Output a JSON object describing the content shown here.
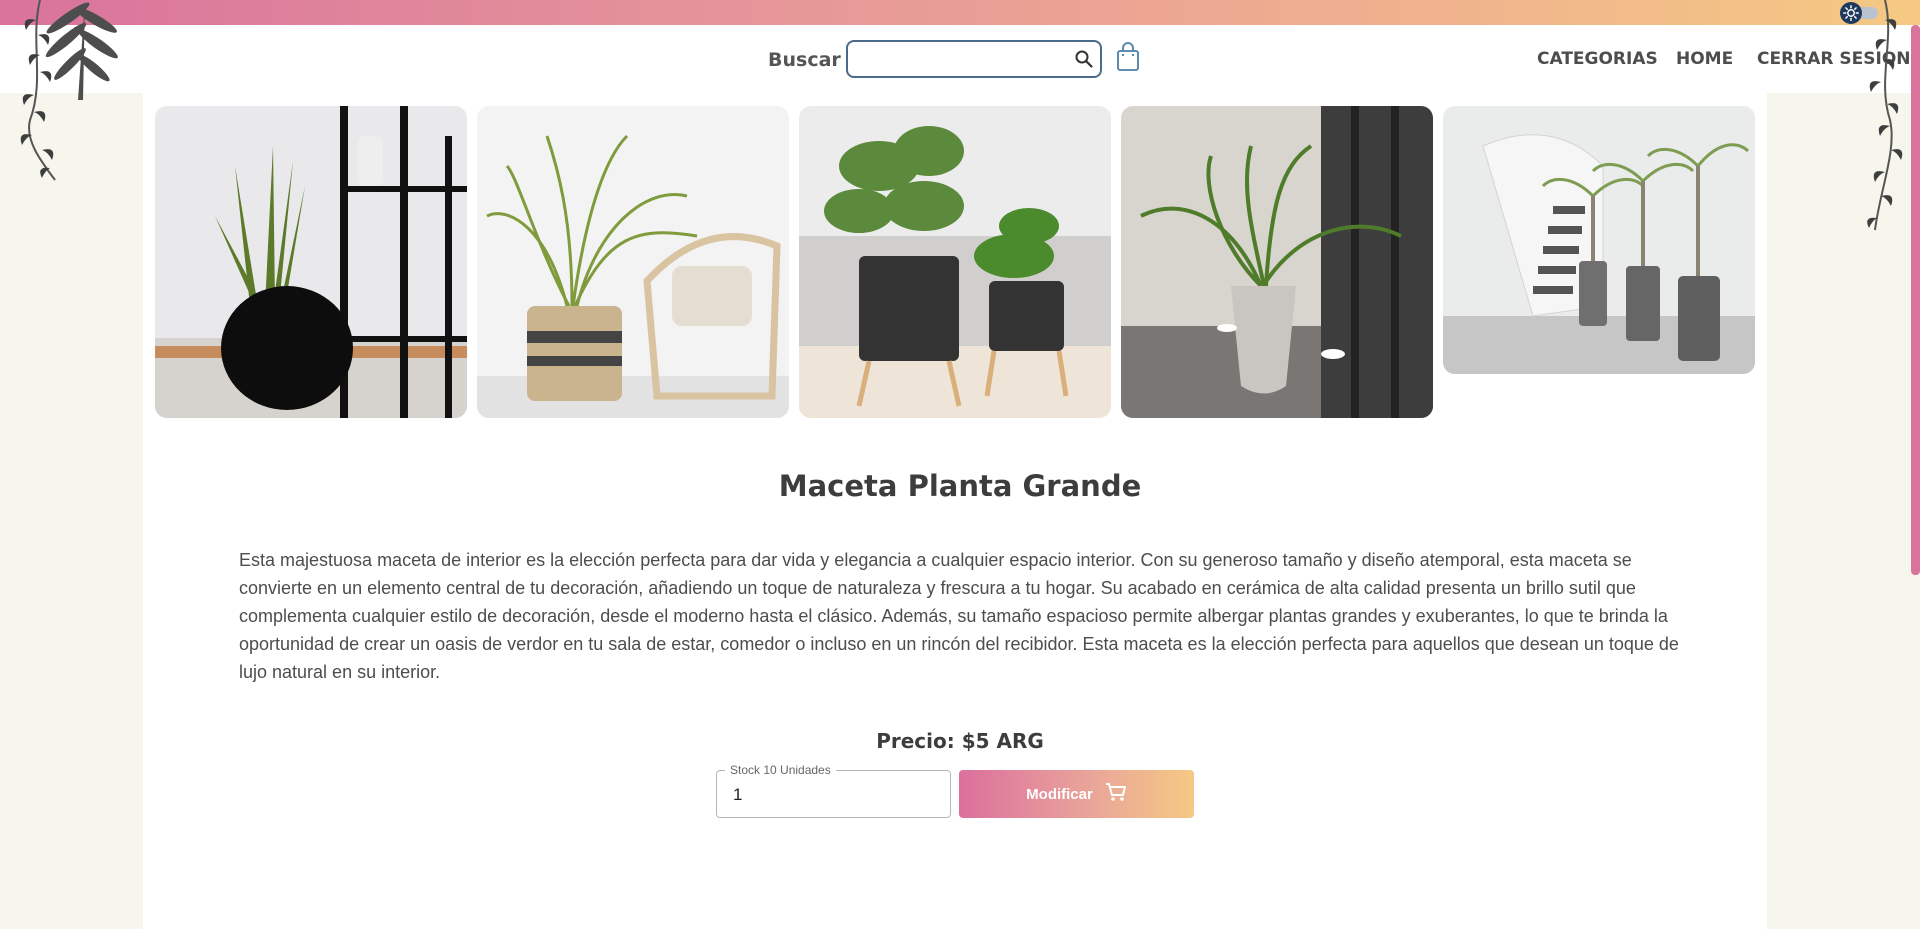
{
  "header": {
    "search_label": "Buscar",
    "search_value": "",
    "nav": [
      "CATEGORIAS",
      "HOME",
      "CERRAR SESION"
    ]
  },
  "icons": {
    "theme": "sun-icon",
    "search": "search-icon",
    "cart": "shopping-bag-icon",
    "button": "shopping-cart-icon",
    "decor": "hanging-vine-icon"
  },
  "gallery": [
    {
      "name": "snake-plant-black-pot"
    },
    {
      "name": "palm-wicker-basket-chair"
    },
    {
      "name": "calathea-fern-stands"
    },
    {
      "name": "palm-grey-planter-lobby"
    },
    {
      "name": "ponytail-palms-staircase"
    }
  ],
  "product": {
    "title": "Maceta Planta Grande",
    "description": "Esta majestuosa maceta de interior es la elección perfecta para dar vida y elegancia a cualquier espacio interior. Con su generoso tamaño y diseño atemporal, esta maceta se convierte en un elemento central de tu decoración, añadiendo un toque de naturaleza y frescura a tu hogar. Su acabado en cerámica de alta calidad presenta un brillo sutil que complementa cualquier estilo de decoración, desde el moderno hasta el clásico. Además, su tamaño espacioso permite albergar plantas grandes y exuberantes, lo que te brinda la oportunidad de crear un oasis de verdor en tu sala de estar, comedor o incluso en un rincón del recibidor. Esta maceta es la elección perfecta para aquellos que desean un toque de lujo natural en su interior.",
    "price": "Precio: $5 ARG",
    "stock_label": "Stock 10 Unidades",
    "quantity": "1",
    "button_label": "Modificar"
  },
  "colors": {
    "gradient_start": "#d9739c",
    "gradient_end": "#f5c983",
    "page_bg": "#f7f6ec",
    "search_border": "#4a6c8a"
  }
}
